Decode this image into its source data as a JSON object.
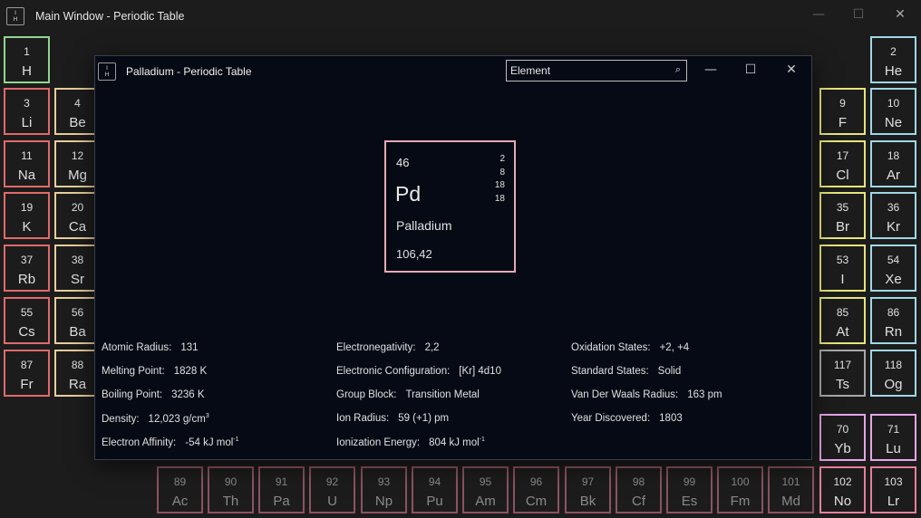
{
  "main_window": {
    "title": "Main Window - Periodic Table",
    "icon_lines": [
      "I",
      "H"
    ],
    "controls": {
      "minimize": "—",
      "maximize": "☐",
      "close": "✕"
    }
  },
  "tiles": [
    {
      "num": "1",
      "sym": "H",
      "color": "#8fd68f"
    },
    {
      "num": "2",
      "sym": "He",
      "color": "#9fd7e6"
    },
    {
      "num": "3",
      "sym": "Li",
      "color": "#e06a6a"
    },
    {
      "num": "4",
      "sym": "Be",
      "color": "#e8cc9a"
    },
    {
      "num": "9",
      "sym": "F",
      "color": "#e6e67a"
    },
    {
      "num": "10",
      "sym": "Ne",
      "color": "#9fd7e6"
    },
    {
      "num": "11",
      "sym": "Na",
      "color": "#e06a6a"
    },
    {
      "num": "12",
      "sym": "Mg",
      "color": "#e8cc9a"
    },
    {
      "num": "17",
      "sym": "Cl",
      "color": "#e6e67a"
    },
    {
      "num": "18",
      "sym": "Ar",
      "color": "#9fd7e6"
    },
    {
      "num": "19",
      "sym": "K",
      "color": "#e06a6a"
    },
    {
      "num": "20",
      "sym": "Ca",
      "color": "#e8cc9a"
    },
    {
      "num": "35",
      "sym": "Br",
      "color": "#e6e67a"
    },
    {
      "num": "36",
      "sym": "Kr",
      "color": "#9fd7e6"
    },
    {
      "num": "37",
      "sym": "Rb",
      "color": "#e06a6a"
    },
    {
      "num": "38",
      "sym": "Sr",
      "color": "#e8cc9a"
    },
    {
      "num": "53",
      "sym": "I",
      "color": "#e6e67a"
    },
    {
      "num": "54",
      "sym": "Xe",
      "color": "#9fd7e6"
    },
    {
      "num": "55",
      "sym": "Cs",
      "color": "#e06a6a"
    },
    {
      "num": "56",
      "sym": "Ba",
      "color": "#e8cc9a"
    },
    {
      "num": "85",
      "sym": "At",
      "color": "#e6e67a"
    },
    {
      "num": "86",
      "sym": "Rn",
      "color": "#9fd7e6"
    },
    {
      "num": "87",
      "sym": "Fr",
      "color": "#e06a6a"
    },
    {
      "num": "88",
      "sym": "Ra",
      "color": "#e8cc9a"
    },
    {
      "num": "117",
      "sym": "Ts",
      "color": "#a8a8a8"
    },
    {
      "num": "118",
      "sym": "Og",
      "color": "#9fd7e6"
    },
    {
      "num": "70",
      "sym": "Yb",
      "color": "#e6a6e6"
    },
    {
      "num": "71",
      "sym": "Lu",
      "color": "#e6a6e6"
    },
    {
      "num": "89",
      "sym": "Ac",
      "color": "#e6809a"
    },
    {
      "num": "90",
      "sym": "Th",
      "color": "#e6809a"
    },
    {
      "num": "91",
      "sym": "Pa",
      "color": "#e6809a"
    },
    {
      "num": "92",
      "sym": "U",
      "color": "#e6809a"
    },
    {
      "num": "93",
      "sym": "Np",
      "color": "#e6809a"
    },
    {
      "num": "94",
      "sym": "Pu",
      "color": "#e6809a"
    },
    {
      "num": "95",
      "sym": "Am",
      "color": "#e6809a"
    },
    {
      "num": "96",
      "sym": "Cm",
      "color": "#e6809a"
    },
    {
      "num": "97",
      "sym": "Bk",
      "color": "#e6809a"
    },
    {
      "num": "98",
      "sym": "Cf",
      "color": "#e6809a"
    },
    {
      "num": "99",
      "sym": "Es",
      "color": "#e6809a"
    },
    {
      "num": "100",
      "sym": "Fm",
      "color": "#e6809a"
    },
    {
      "num": "101",
      "sym": "Md",
      "color": "#e6809a"
    },
    {
      "num": "102",
      "sym": "No",
      "color": "#e6809a"
    },
    {
      "num": "103",
      "sym": "Lr",
      "color": "#e6809a"
    }
  ],
  "popup": {
    "title": "Palladium - Periodic Table",
    "icon_lines": [
      "I",
      "H"
    ],
    "search": {
      "placeholder": "Element",
      "icon": "⌕"
    },
    "controls": {
      "minimize": "—",
      "maximize": "☐",
      "close": "✕"
    }
  },
  "card": {
    "atomic_number": "46",
    "symbol": "Pd",
    "name": "Palladium",
    "mass": "106,42",
    "shells": [
      "2",
      "8",
      "18",
      "18"
    ],
    "border_color": "#e7a9b4"
  },
  "properties": {
    "atomic_radius": {
      "label": "Atomic Radius:",
      "value": "131"
    },
    "melting_point": {
      "label": "Melting Point:",
      "value": "1828 K"
    },
    "boiling_point": {
      "label": "Boiling Point:",
      "value": "3236 K"
    },
    "density": {
      "label": "Density:",
      "value": "12,023 g/cm",
      "sup": "3"
    },
    "electron_affinity": {
      "label": "Electron Affinity:",
      "value": "-54 kJ mol",
      "sup": "-1"
    },
    "electronegativity": {
      "label": "Electronegativity:",
      "value": "2,2"
    },
    "electronic_configuration": {
      "label": "Electronic Configuration:",
      "value": "[Kr] 4d10"
    },
    "group_block": {
      "label": "Group Block:",
      "value": "Transition Metal"
    },
    "ion_radius": {
      "label": "Ion Radius:",
      "value": "59 (+1) pm"
    },
    "ionization_energy": {
      "label": "Ionization Energy:",
      "value": "804 kJ mol",
      "sup": "-1"
    },
    "oxidation_states": {
      "label": "Oxidation States:",
      "value": "+2, +4"
    },
    "standard_states": {
      "label": "Standard States:",
      "value": "Solid"
    },
    "van_der_waals_radius": {
      "label": "Van Der Waals Radius:",
      "value": "163 pm"
    },
    "year_discovered": {
      "label": "Year Discovered:",
      "value": "1803"
    }
  }
}
